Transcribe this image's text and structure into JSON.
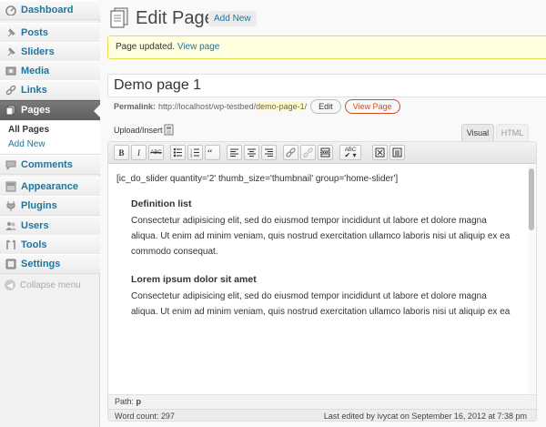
{
  "sidebar": {
    "items": [
      {
        "label": "Dashboard",
        "icon": "dashboard-icon"
      },
      {
        "label": "Posts",
        "icon": "pushpin-icon"
      },
      {
        "label": "Sliders",
        "icon": "pushpin-icon"
      },
      {
        "label": "Media",
        "icon": "media-icon"
      },
      {
        "label": "Links",
        "icon": "link-icon"
      },
      {
        "label": "Pages",
        "icon": "pages-icon"
      },
      {
        "label": "Comments",
        "icon": "comment-icon"
      },
      {
        "label": "Appearance",
        "icon": "appearance-icon"
      },
      {
        "label": "Plugins",
        "icon": "plugin-icon"
      },
      {
        "label": "Users",
        "icon": "users-icon"
      },
      {
        "label": "Tools",
        "icon": "tools-icon"
      },
      {
        "label": "Settings",
        "icon": "settings-icon"
      }
    ],
    "submenu": {
      "all_pages": "All Pages",
      "add_new": "Add New"
    },
    "collapse": "Collapse menu"
  },
  "header": {
    "title": "Edit Page",
    "add_new": "Add New"
  },
  "notice": {
    "text": "Page updated.",
    "link": "View page"
  },
  "title_input": {
    "value": "Demo page 1"
  },
  "permalink": {
    "label": "Permalink:",
    "base": "http://localhost/wp-testbed/",
    "slug": "demo-page-1",
    "suffix": "/",
    "edit": "Edit",
    "view": "View Page"
  },
  "editor": {
    "upload_insert": "Upload/Insert",
    "tabs": {
      "visual": "Visual",
      "html": "HTML"
    },
    "toolbar": {
      "bold": "B",
      "italic": "I",
      "strike": "ABC",
      "spellcheck": "ABC"
    },
    "content": {
      "shortcode": "[ic_do_slider quantity='2' thumb_size='thumbnail' group='home-slider']",
      "sections": [
        {
          "heading": "Definition list",
          "lines": [
            "Consectetur adipisicing elit, sed do eiusmod tempor incididunt ut labore et dolore magna",
            "aliqua. Ut enim ad minim veniam, quis nostrud exercitation ullamco laboris nisi ut aliquip ex ea",
            "commodo consequat."
          ]
        },
        {
          "heading": "Lorem ipsum dolor sit amet",
          "lines": [
            "Consectetur adipisicing elit, sed do eiusmod tempor incididunt ut labore et dolore magna",
            "aliqua. Ut enim ad minim veniam, quis nostrud exercitation ullamco laboris nisi ut aliquip ex ea"
          ]
        }
      ]
    },
    "path_label": "Path:",
    "path_value": "p",
    "word_count": "Word count: 297",
    "last_edited": "Last edited by ivycat on September 16, 2012 at 7:38 pm"
  },
  "colors": {
    "link": "#21759b",
    "notice_bg": "#ffffe0",
    "notice_border": "#e6db55",
    "current_menu": "#6d6d6d",
    "view_page": "#d54e21"
  }
}
